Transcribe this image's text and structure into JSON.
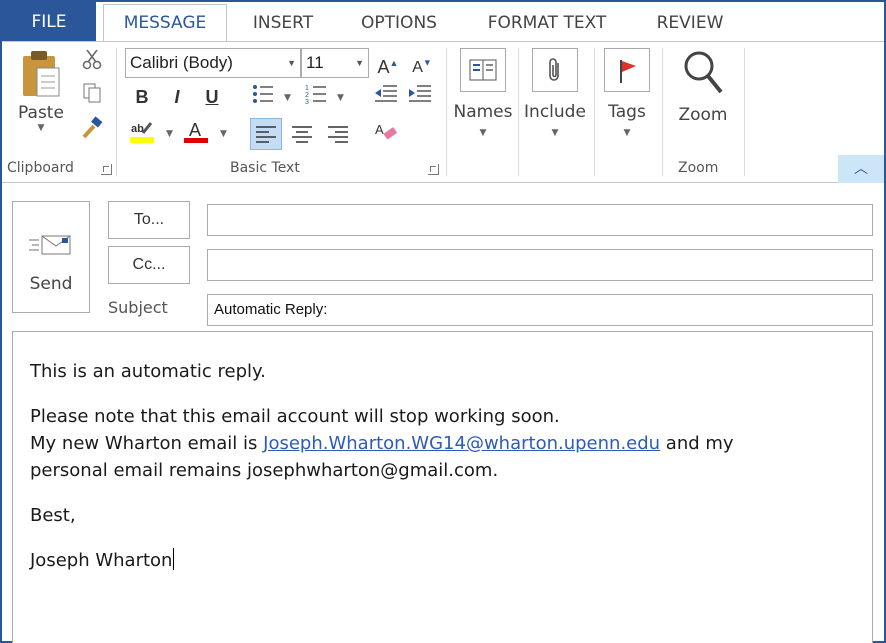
{
  "tabs": [
    {
      "label": "FILE"
    },
    {
      "label": "MESSAGE"
    },
    {
      "label": "INSERT"
    },
    {
      "label": "OPTIONS"
    },
    {
      "label": "FORMAT TEXT"
    },
    {
      "label": "REVIEW"
    }
  ],
  "active_tab": "MESSAGE",
  "ribbon": {
    "clipboard": {
      "paste_label": "Paste",
      "group_label": "Clipboard"
    },
    "basic_text": {
      "font_name": "Calibri (Body)",
      "font_size": "11",
      "bold": "B",
      "italic": "I",
      "underline": "U",
      "group_label": "Basic Text",
      "highlight_color": "#ffff00",
      "font_color": "#e00000"
    },
    "names": {
      "label": "Names"
    },
    "include": {
      "label": "Include"
    },
    "tags": {
      "label": "Tags"
    },
    "zoom": {
      "label": "Zoom",
      "group_label": "Zoom"
    }
  },
  "compose": {
    "send_label": "Send",
    "to_label": "To...",
    "cc_label": "Cc...",
    "to_value": "",
    "cc_value": "",
    "subject_label": "Subject",
    "subject_value": "Automatic Reply:"
  },
  "body": {
    "line1": "This is an automatic reply.",
    "line2": "Please note that this email account will stop working soon.",
    "line3_pre": "My new Wharton email is ",
    "line3_link": "Joseph.Wharton.WG14@wharton.upenn.edu",
    "line3_post": " and my",
    "line4": "personal email remains josephwharton@gmail.com.",
    "closing": "Best,",
    "signature": "Joseph Wharton"
  },
  "colors": {
    "accent": "#2b579a",
    "link": "#2e5ab8"
  }
}
